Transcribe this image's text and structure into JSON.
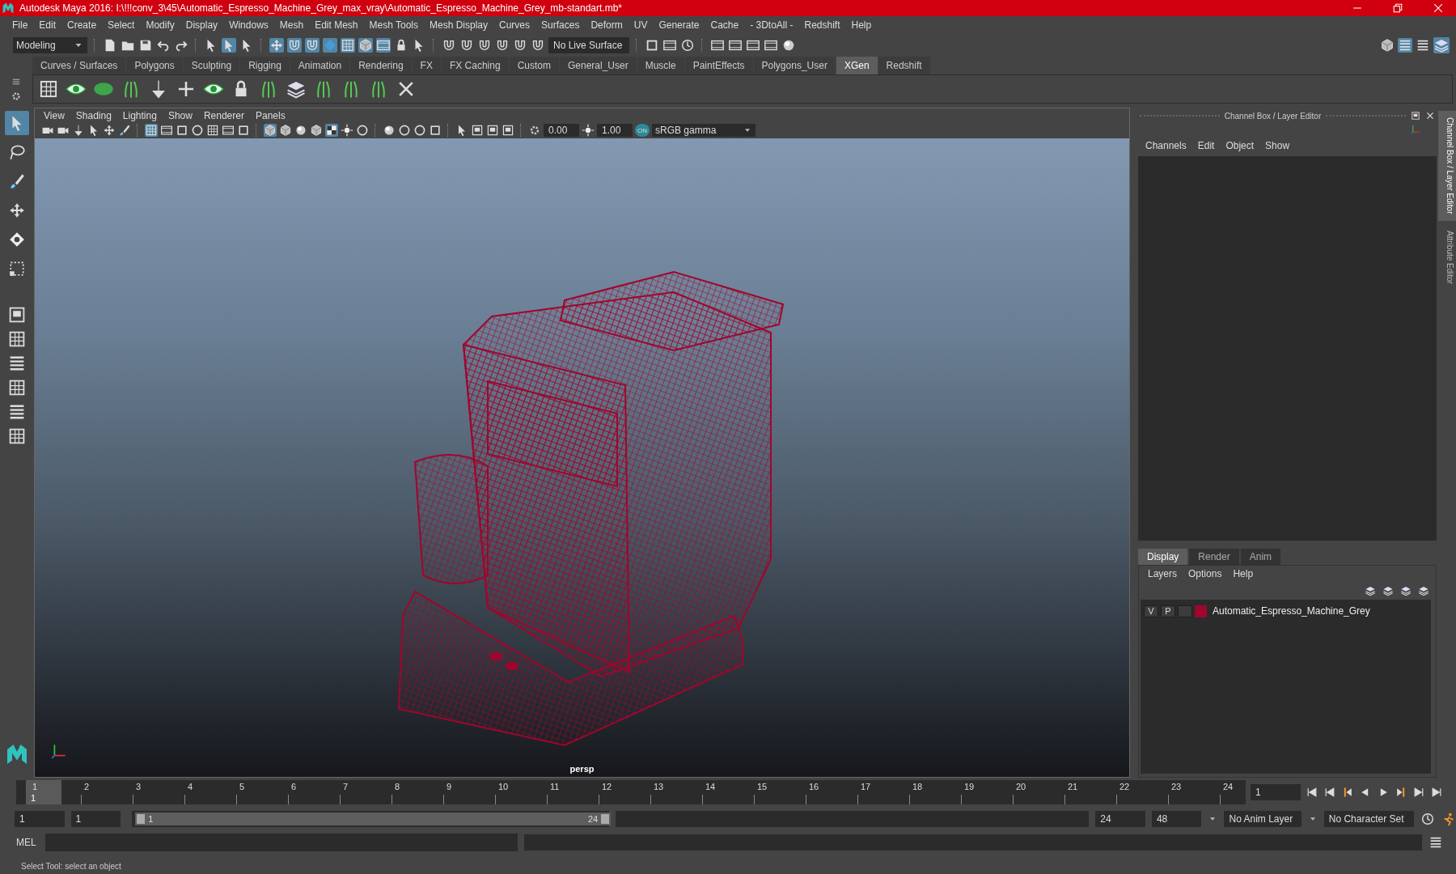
{
  "window": {
    "title": "Autodesk Maya 2016: I:\\!!!conv_3\\45\\Automatic_Espresso_Machine_Grey_max_vray\\Automatic_Espresso_Machine_Grey_mb-standart.mb*"
  },
  "menu": [
    "File",
    "Edit",
    "Create",
    "Select",
    "Modify",
    "Display",
    "Windows",
    "Mesh",
    "Edit Mesh",
    "Mesh Tools",
    "Mesh Display",
    "Curves",
    "Surfaces",
    "Deform",
    "UV",
    "Generate",
    "Cache",
    "- 3DtoAll -",
    "Redshift",
    "Help"
  ],
  "status_line": {
    "workspace": "Modeling",
    "live_surface": "No Live Surface"
  },
  "shelf_tabs": [
    {
      "label": "Curves / Surfaces",
      "selected": false
    },
    {
      "label": "Polygons",
      "selected": false
    },
    {
      "label": "Sculpting",
      "selected": false
    },
    {
      "label": "Rigging",
      "selected": false
    },
    {
      "label": "Animation",
      "selected": false
    },
    {
      "label": "Rendering",
      "selected": false
    },
    {
      "label": "FX",
      "selected": false
    },
    {
      "label": "FX Caching",
      "selected": false
    },
    {
      "label": "Custom",
      "selected": false
    },
    {
      "label": "General_User",
      "selected": false
    },
    {
      "label": "Muscle",
      "selected": false
    },
    {
      "label": "PaintEffects",
      "selected": false
    },
    {
      "label": "Polygons_User",
      "selected": false
    },
    {
      "label": "XGen",
      "selected": true
    },
    {
      "label": "Redshift",
      "selected": false
    }
  ],
  "toolbox": [
    {
      "selected": true
    },
    {
      "selected": false
    },
    {
      "selected": false
    },
    {
      "selected": false
    },
    {
      "selected": false
    },
    {
      "selected": false
    }
  ],
  "viewport": {
    "menu": [
      "View",
      "Shading",
      "Lighting",
      "Show",
      "Renderer",
      "Panels"
    ],
    "exposure": "0.00",
    "gamma": "1.00",
    "color_management": "ON",
    "color_space": "sRGB gamma",
    "camera": "persp"
  },
  "channel_box": {
    "title": "Channel Box / Layer Editor",
    "menu": [
      "Channels",
      "Edit",
      "Object",
      "Show"
    ]
  },
  "side_tabs": [
    {
      "label": "Channel Box / Layer Editor",
      "selected": true
    },
    {
      "label": "Attribute Editor",
      "selected": false
    }
  ],
  "layer_editor": {
    "tabs": [
      {
        "label": "Display",
        "selected": true
      },
      {
        "label": "Render",
        "selected": false
      },
      {
        "label": "Anim",
        "selected": false
      }
    ],
    "menu": [
      "Layers",
      "Options",
      "Help"
    ],
    "layers": [
      {
        "visibility": "V",
        "playback": "P",
        "name": "Automatic_Espresso_Machine_Grey",
        "color": "#a0062c"
      }
    ]
  },
  "timeline": {
    "ticks": [
      "1",
      "2",
      "3",
      "4",
      "5",
      "6",
      "7",
      "8",
      "9",
      "10",
      "11",
      "12",
      "13",
      "14",
      "15",
      "16",
      "17",
      "18",
      "19",
      "20",
      "21",
      "22",
      "23",
      "24"
    ],
    "current_frame": "1",
    "frame_field": "1",
    "level": 0
  },
  "range": {
    "start": "1",
    "playback_start": "1",
    "slider_start": "1",
    "slider_end": "24",
    "level": 1,
    "playback_end": "24",
    "end": "48",
    "anim_layer": "No Anim Layer",
    "character_set": "No Character Set"
  },
  "command_line": {
    "label": "MEL"
  },
  "help_line": "Select Tool: select an object"
}
